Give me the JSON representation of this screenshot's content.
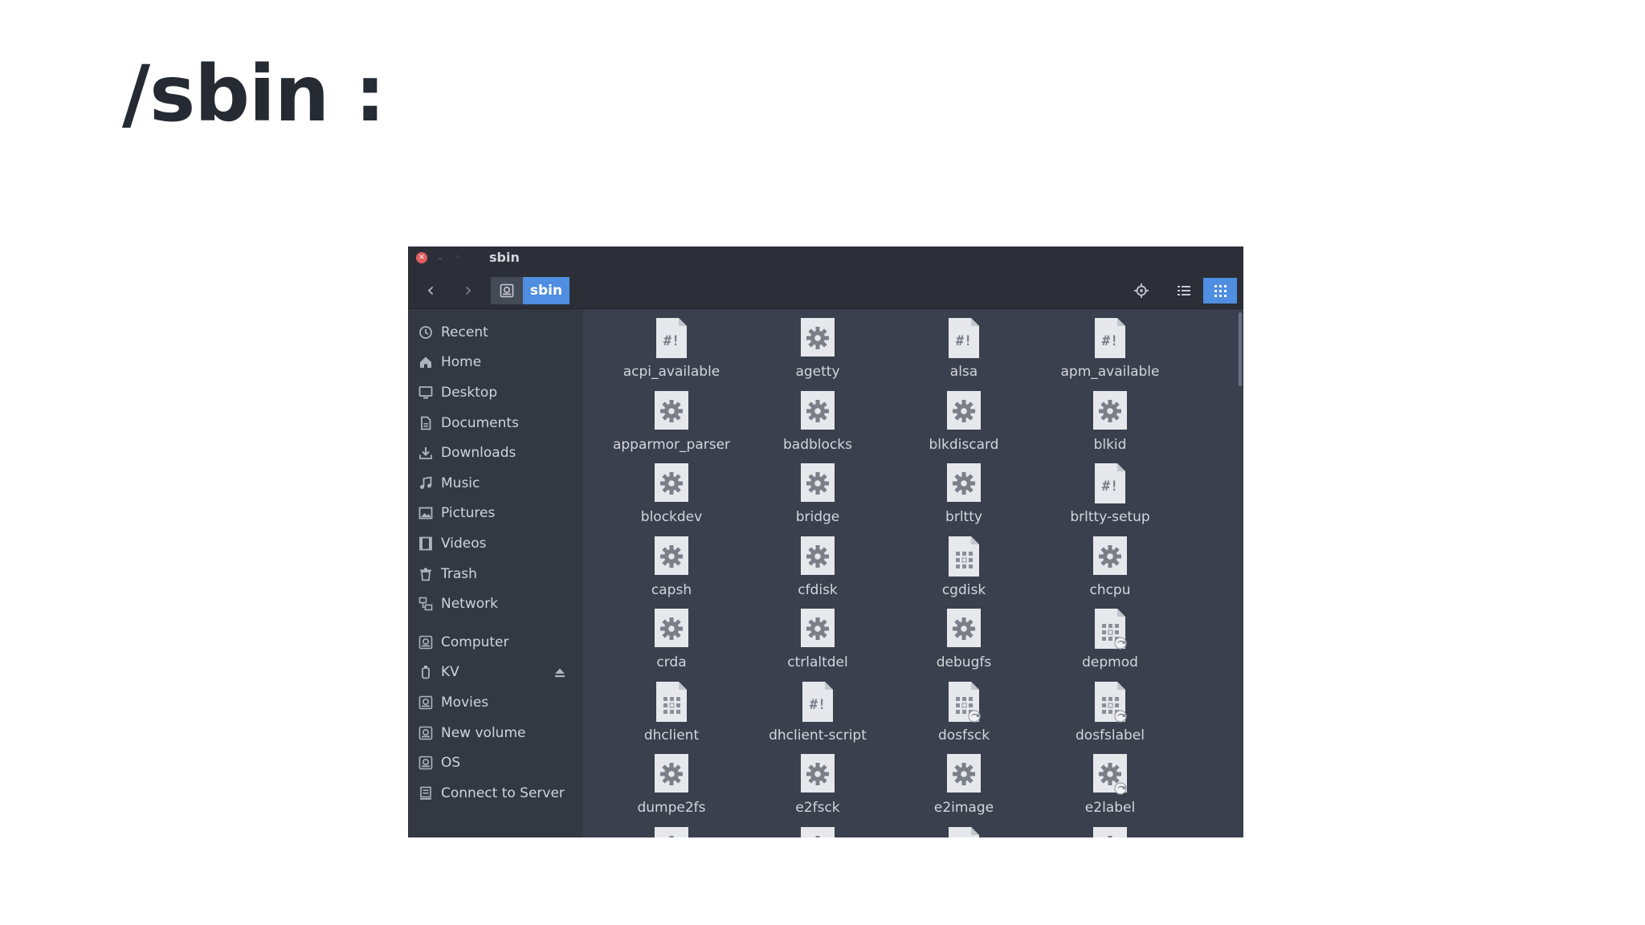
{
  "slide": {
    "title": "/sbin :"
  },
  "window": {
    "title": "sbin",
    "breadcrumb": {
      "current": "sbin"
    },
    "accent_color": "#4f8ee0"
  },
  "sidebar": {
    "places": [
      {
        "label": "Recent",
        "icon": "clock-icon"
      },
      {
        "label": "Home",
        "icon": "home-icon"
      },
      {
        "label": "Desktop",
        "icon": "desktop-icon"
      },
      {
        "label": "Documents",
        "icon": "document-icon"
      },
      {
        "label": "Downloads",
        "icon": "download-icon"
      },
      {
        "label": "Music",
        "icon": "music-icon"
      },
      {
        "label": "Pictures",
        "icon": "picture-icon"
      },
      {
        "label": "Videos",
        "icon": "video-icon"
      },
      {
        "label": "Trash",
        "icon": "trash-icon"
      },
      {
        "label": "Network",
        "icon": "network-icon"
      }
    ],
    "devices": [
      {
        "label": "Computer",
        "icon": "drive-icon"
      },
      {
        "label": "KV",
        "icon": "usb-icon",
        "ejectable": true
      },
      {
        "label": "Movies",
        "icon": "drive-icon"
      },
      {
        "label": "New volume",
        "icon": "drive-icon"
      },
      {
        "label": "OS",
        "icon": "drive-icon"
      },
      {
        "label": "Connect to Server",
        "icon": "server-icon"
      }
    ]
  },
  "files": [
    {
      "name": "acpi_available",
      "type": "script"
    },
    {
      "name": "agetty",
      "type": "executable"
    },
    {
      "name": "alsa",
      "type": "script"
    },
    {
      "name": "apm_available",
      "type": "script"
    },
    {
      "name": "apparmor_parser",
      "type": "executable"
    },
    {
      "name": "badblocks",
      "type": "executable"
    },
    {
      "name": "blkdiscard",
      "type": "executable"
    },
    {
      "name": "blkid",
      "type": "executable"
    },
    {
      "name": "blockdev",
      "type": "executable"
    },
    {
      "name": "bridge",
      "type": "executable"
    },
    {
      "name": "brltty",
      "type": "executable"
    },
    {
      "name": "brltty-setup",
      "type": "script"
    },
    {
      "name": "capsh",
      "type": "executable"
    },
    {
      "name": "cfdisk",
      "type": "executable"
    },
    {
      "name": "cgdisk",
      "type": "binary"
    },
    {
      "name": "chcpu",
      "type": "executable"
    },
    {
      "name": "crda",
      "type": "executable"
    },
    {
      "name": "ctrlaltdel",
      "type": "executable"
    },
    {
      "name": "debugfs",
      "type": "executable"
    },
    {
      "name": "depmod",
      "type": "binary-link"
    },
    {
      "name": "dhclient",
      "type": "binary"
    },
    {
      "name": "dhclient-script",
      "type": "script"
    },
    {
      "name": "dosfsck",
      "type": "binary-link"
    },
    {
      "name": "dosfslabel",
      "type": "binary-link"
    },
    {
      "name": "dumpe2fs",
      "type": "executable"
    },
    {
      "name": "e2fsck",
      "type": "executable"
    },
    {
      "name": "e2image",
      "type": "executable"
    },
    {
      "name": "e2label",
      "type": "executable-link"
    }
  ]
}
